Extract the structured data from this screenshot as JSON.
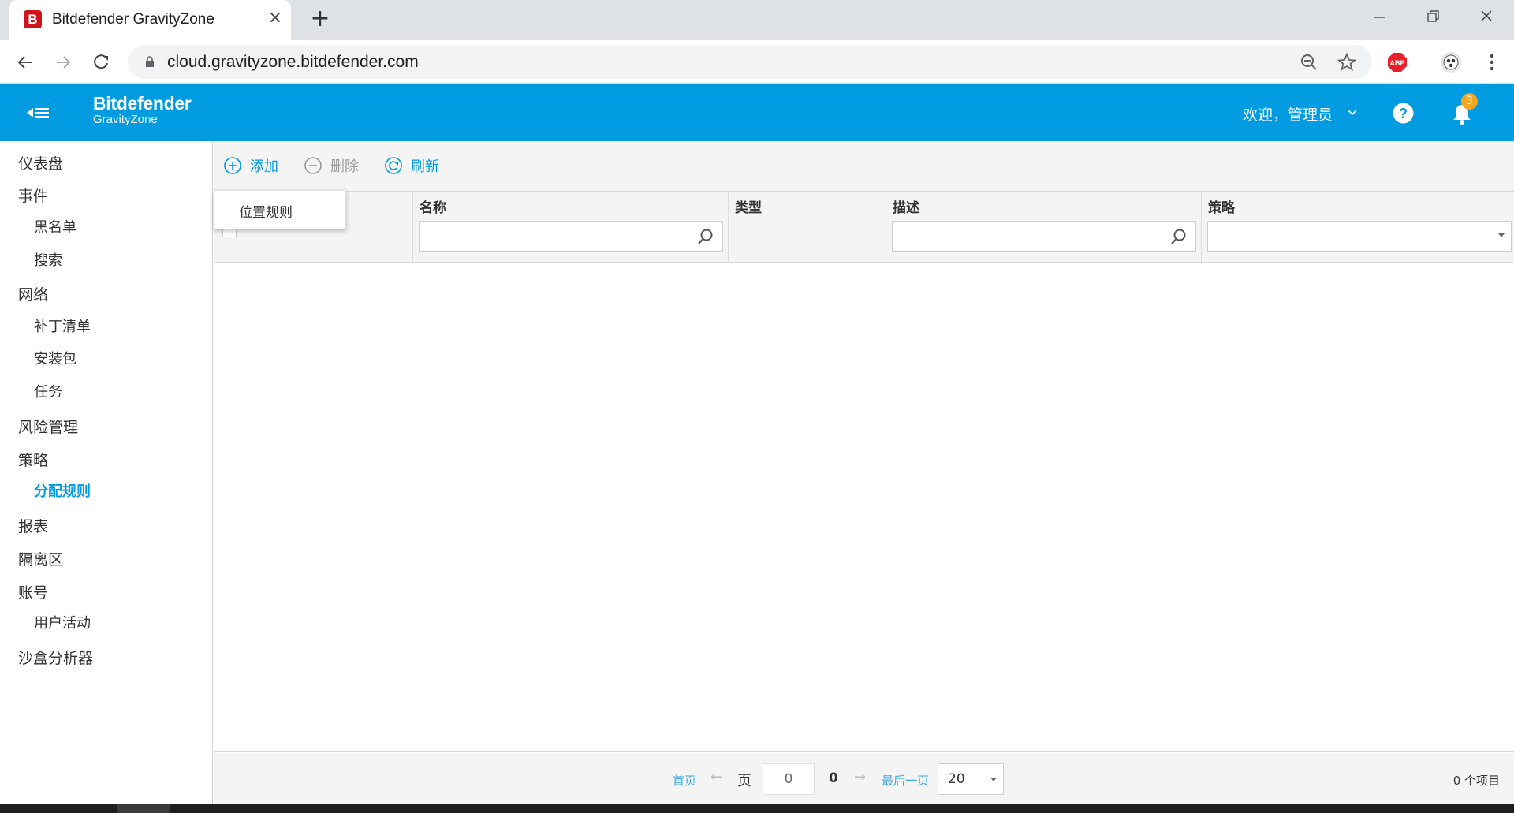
{
  "browser": {
    "tab_title": "Bitdefender GravityZone",
    "favicon_letter": "B",
    "url": "cloud.gravityzone.bitdefender.com",
    "abp_label": "ABP"
  },
  "header": {
    "brand_name": "Bitdefender",
    "brand_product": "GravityZone",
    "welcome": "欢迎，管理员",
    "notification_count": "3",
    "accent_color": "#009be0"
  },
  "sidebar": {
    "items": [
      {
        "label": "仪表盘",
        "level": 1
      },
      {
        "label": "事件",
        "level": 1
      },
      {
        "label": "黑名单",
        "level": 2
      },
      {
        "label": "搜索",
        "level": 2
      },
      {
        "label": "网络",
        "level": 1
      },
      {
        "label": "补丁清单",
        "level": 2
      },
      {
        "label": "安装包",
        "level": 2
      },
      {
        "label": "任务",
        "level": 2
      },
      {
        "label": "风险管理",
        "level": 1
      },
      {
        "label": "策略",
        "level": 1
      },
      {
        "label": "分配规则",
        "level": 2,
        "active": true
      },
      {
        "label": "报表",
        "level": 1
      },
      {
        "label": "隔离区",
        "level": 1
      },
      {
        "label": "账号",
        "level": 1
      },
      {
        "label": "用户活动",
        "level": 2
      },
      {
        "label": "沙盒分析器",
        "level": 1
      }
    ]
  },
  "toolbar": {
    "add_label": "添加",
    "delete_label": "删除",
    "refresh_label": "刷新"
  },
  "add_menu": {
    "items": [
      "位置规则"
    ]
  },
  "grid": {
    "columns": [
      "名称",
      "类型",
      "描述",
      "策略"
    ],
    "rows": []
  },
  "pager": {
    "first": "首页",
    "prev": "←",
    "page_label": "页",
    "page_value": "0",
    "total_pages": "0",
    "next": "→",
    "last": "最后一页",
    "page_size": "20",
    "item_count": "0 个项目"
  }
}
